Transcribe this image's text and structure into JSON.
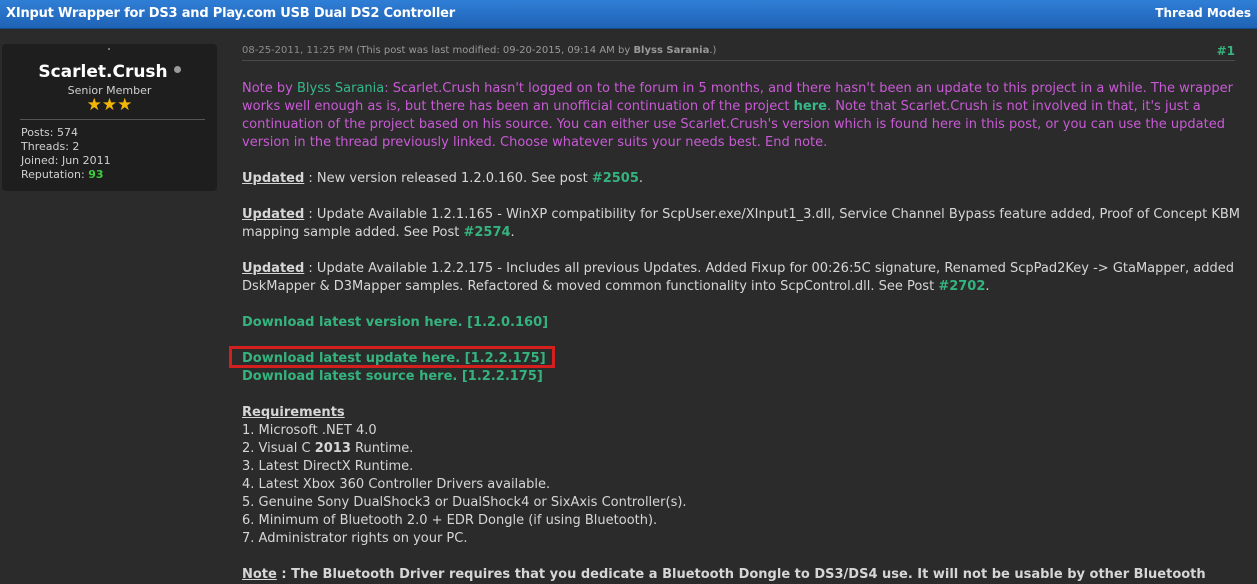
{
  "header": {
    "title": "XInput Wrapper for DS3 and Play.com USB Dual DS2 Controller",
    "thread_modes": "Thread Modes"
  },
  "user": {
    "name": "Scarlet.Crush",
    "title": "Senior Member",
    "stars": "★★★",
    "posts": "Posts: 574",
    "threads": "Threads: 2",
    "joined": "Joined: Jun 2011",
    "reputation_label": "Reputation:",
    "reputation_value": "93"
  },
  "post": {
    "date": "08-25-2011, 11:25 PM",
    "modified_prefix": "(This post was last modified: 09-20-2015, 09:14 AM by",
    "modified_by": "Blyss Sarania",
    "modified_suffix": ".)",
    "number": "#1",
    "note": {
      "prefix": "Note by ",
      "author": "Blyss Sarania",
      "text1": ": Scarlet.Crush hasn't logged on to the forum in 5 months, and there hasn't been an update to this project in a while. The wrapper works well enough as is, but there has been an unofficial continuation of the project ",
      "link": "here",
      "text2": ". Note that Scarlet.Crush is not involved in that, it's just a continuation of the project based on his source. You can either use Scarlet.Crush's version which is found here in this post, or you can use the updated version in the thread previously linked. Choose whatever suits your needs best. End note."
    },
    "updates": [
      {
        "label": "Updated",
        "text": " : New version released 1.2.0.160. See post  ",
        "link": "#2505",
        "suffix": "."
      },
      {
        "label": "Updated",
        "text": " : Update Available 1.2.1.165 - WinXP compatibility for ScpUser.exe/XInput1_3.dll, Service Channel Bypass feature added, Proof of Concept KBM mapping sample added. See Post ",
        "link": "#2574",
        "suffix": "."
      },
      {
        "label": "Updated",
        "text": " : Update Available 1.2.2.175 - Includes all previous Updates. Added Fixup for 00:26:5C signature, Renamed ScpPad2Key -> GtaMapper, added DskMapper & D3Mapper samples. Refactored & moved common functionality into ScpControl.dll. See Post ",
        "link": "#2702",
        "suffix": "."
      }
    ],
    "downloads": {
      "version": "Download latest version here. [1.2.0.160]",
      "update": "Download latest update here. [1.2.2.175]",
      "source": "Download latest source here. [1.2.2.175]"
    },
    "requirements": {
      "title": "Requirements",
      "items": [
        "1. Microsoft .NET 4.0",
        "2. Visual C ",
        "3. Latest DirectX Runtime.",
        "4. Latest Xbox 360 Controller Drivers available.",
        "5. Genuine Sony DualShock3 or DualShock4 or SixAxis Controller(s).",
        "6. Minimum of Bluetooth 2.0 + EDR Dongle (if using Bluetooth).",
        "7. Administrator rights on your PC."
      ],
      "vc_bold": "2013",
      "vc_suffix": " Runtime."
    },
    "bottom_note": {
      "label": "Note",
      "text": " : The Bluetooth Driver requires that you dedicate a Bluetooth Dongle to DS3/DS4 use. It will not be usable by other Bluetooth"
    }
  }
}
